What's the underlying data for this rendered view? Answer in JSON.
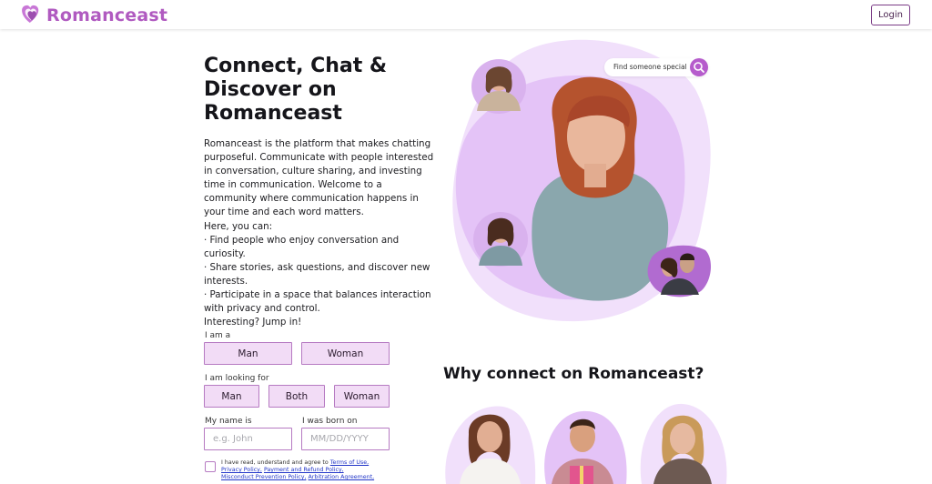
{
  "header": {
    "brand": "Romanceast",
    "login_label": "Login",
    "logo_icon": "double-heart-icon"
  },
  "hero": {
    "title": "Connect, Chat & Discover on Romanceast",
    "paragraphs": [
      "Romanceast is the platform that makes chatting purposeful. Communicate with people interested in conversation, culture sharing, and investing time in communication. Welcome to a community where communication happens in your time and each word matters.",
      "Here, you can:",
      "· Find people who enjoy conversation and curiosity.",
      "· Share stories, ask questions, and discover new interests.",
      "· Participate in a space that balances interaction with privacy and control.",
      "Interesting? Jump in!"
    ]
  },
  "form": {
    "i_am_label": "I am a",
    "i_am_options": [
      "Man",
      "Woman"
    ],
    "looking_for_label": "I am looking for",
    "looking_for_options": [
      "Man",
      "Both",
      "Woman"
    ],
    "name_label": "My name is",
    "name_placeholder": "e.g. John",
    "born_label": "I was born on",
    "born_placeholder": "MM/DD/YYYY",
    "terms_prefix": "I have read, understand and agree to",
    "terms_links": [
      "Terms of Use,",
      "Privacy Policy,",
      "Payment and Refund Policy,",
      "Misconduct Prevention Policy,",
      "Arbitration Agreement,"
    ]
  },
  "search": {
    "pill_text": "Find someone special",
    "icon": "search-icon"
  },
  "why": {
    "title": "Why connect on Romanceast?"
  },
  "colors": {
    "brand": "#b05ac0",
    "option_bg": "#f2dcf6",
    "option_border": "#b67ac2",
    "blob": "#e4c3f7",
    "blob_light": "#f1e0fb",
    "search_button": "#b65ccc",
    "link": "#2236c8"
  }
}
